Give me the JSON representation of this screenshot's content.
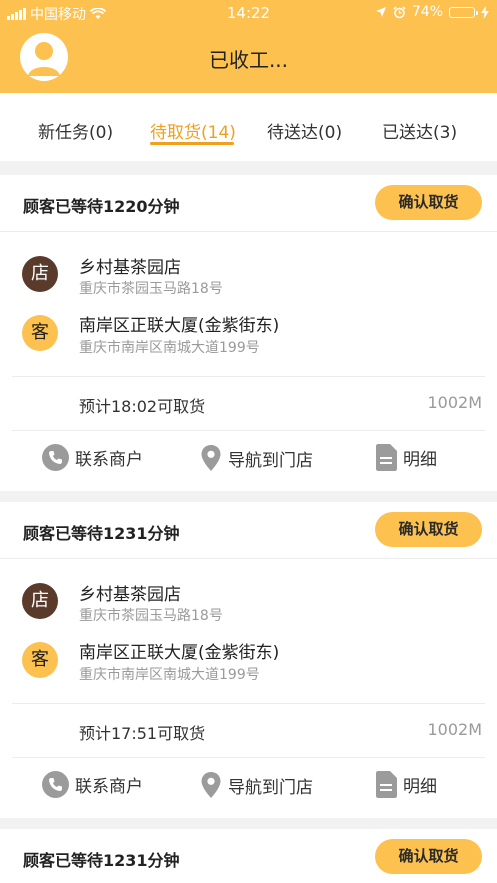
{
  "status_bar": {
    "carrier": "中国移动",
    "time": "14:22",
    "battery": "74%",
    "battery_level": 0.74
  },
  "header": {
    "title": "已收工..."
  },
  "tabs": [
    {
      "label": "新任务(0)"
    },
    {
      "label": "待取货(14)"
    },
    {
      "label": "待送达(0)"
    },
    {
      "label": "已送达(3)"
    }
  ],
  "orders": [
    {
      "wait_text": "顾客已等待1220分钟",
      "confirm_label": "确认取货",
      "shop_badge": "店",
      "shop_name": "乡村基茶园店",
      "shop_address": "重庆市茶园玉马路18号",
      "customer_badge": "客",
      "customer_name": "南岸区正联大厦(金紫街东)",
      "customer_address": "重庆市南岸区南城大道199号",
      "eta": "预计18:02可取货",
      "distance": "1002M",
      "actions": {
        "contact": "联系商户",
        "navigate": "导航到门店",
        "detail": "明细"
      }
    },
    {
      "wait_text": "顾客已等待1231分钟",
      "confirm_label": "确认取货",
      "shop_badge": "店",
      "shop_name": "乡村基茶园店",
      "shop_address": "重庆市茶园玉马路18号",
      "customer_badge": "客",
      "customer_name": "南岸区正联大厦(金紫街东)",
      "customer_address": "重庆市南岸区南城大道199号",
      "eta": "预计17:51可取货",
      "distance": "1002M",
      "actions": {
        "contact": "联系商户",
        "navigate": "导航到门店",
        "detail": "明细"
      }
    },
    {
      "wait_text": "顾客已等待1231分钟",
      "confirm_label": "确认取货"
    }
  ]
}
